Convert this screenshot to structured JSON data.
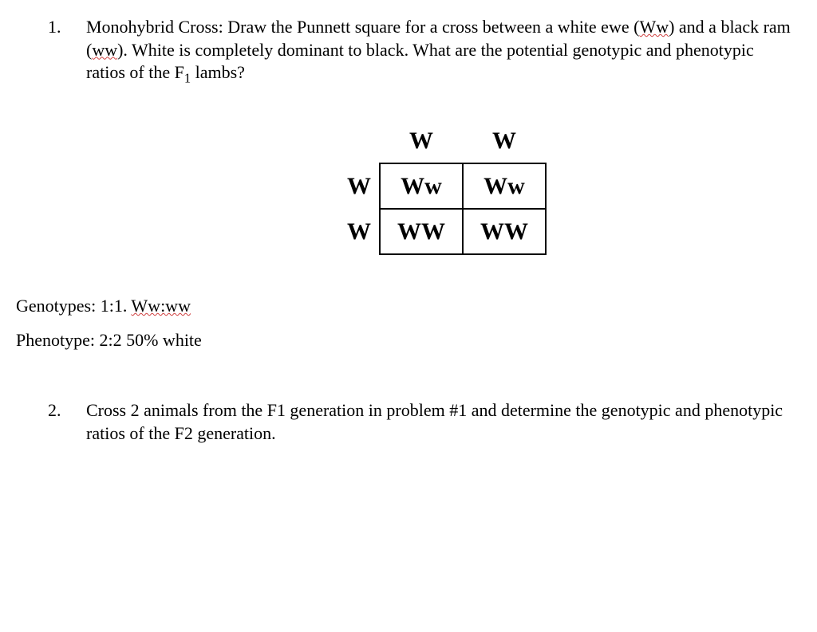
{
  "question1": {
    "number": "1.",
    "lead": "Monohybrid Cross: Draw the Punnett square for a cross between a white ewe (",
    "ww_cap": "Ww",
    "mid1": ") and a black ram (",
    "ww_low": "ww",
    "mid2": "). White is completely dominant to black. What are the potential genotypic and phenotypic ratios of the F",
    "sub": "1",
    "tail": " lambs?"
  },
  "punnett": {
    "top_a": "W",
    "top_b": "W",
    "left_a": "W",
    "left_b": "W",
    "c11": "Ww",
    "c12": "Ww",
    "c21": "WW",
    "c22": "WW"
  },
  "answers": {
    "geno_label": "Genotypes: 1:1. ",
    "geno_squiggle": "Ww:ww",
    "pheno": "Phenotype: 2:2   50% white"
  },
  "question2": {
    "number": "2.",
    "text": "Cross 2 animals from the F1 generation in problem #1 and determine the genotypic and phenotypic ratios of the F2 generation."
  }
}
